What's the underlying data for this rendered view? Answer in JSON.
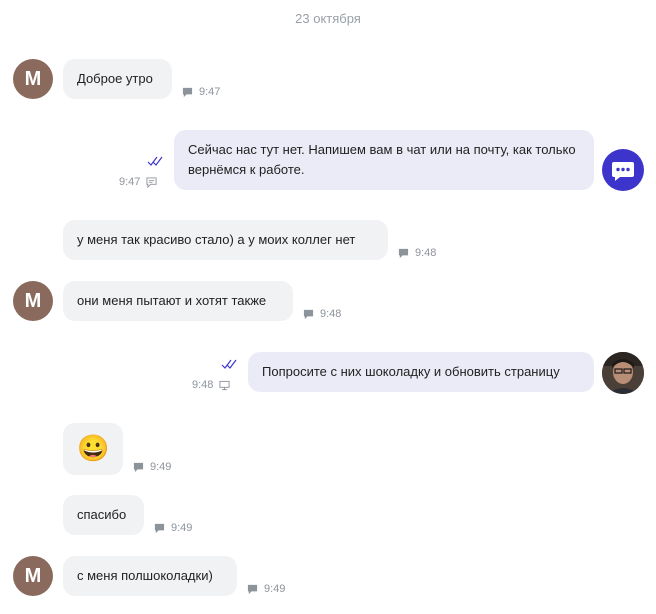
{
  "date_divider": "23 октября",
  "avatar_letter": "М",
  "messages": [
    {
      "text": "Доброе утро",
      "time": "9:47"
    },
    {
      "text": "Сейчас нас тут нет. Напишем вам в чат или на почту, как только вернёмся к работе.",
      "time": "9:47"
    },
    {
      "text": "у меня так красиво стало) а у моих коллег нет",
      "time": "9:48"
    },
    {
      "text": "они меня пытают и хотят также",
      "time": "9:48"
    },
    {
      "text": "Попросите с них шоколадку и обновить страницу",
      "time": "9:48"
    },
    {
      "text": "😀",
      "time": "9:49"
    },
    {
      "text": "спасибо",
      "time": "9:49"
    },
    {
      "text": "с меня полшоколадки)",
      "time": "9:49"
    }
  ],
  "colors": {
    "accent": "#3d34cc",
    "incoming_bubble": "#f1f2f4",
    "outgoing_bubble": "#ebebf7",
    "avatar_bg": "#8a6a5c"
  }
}
